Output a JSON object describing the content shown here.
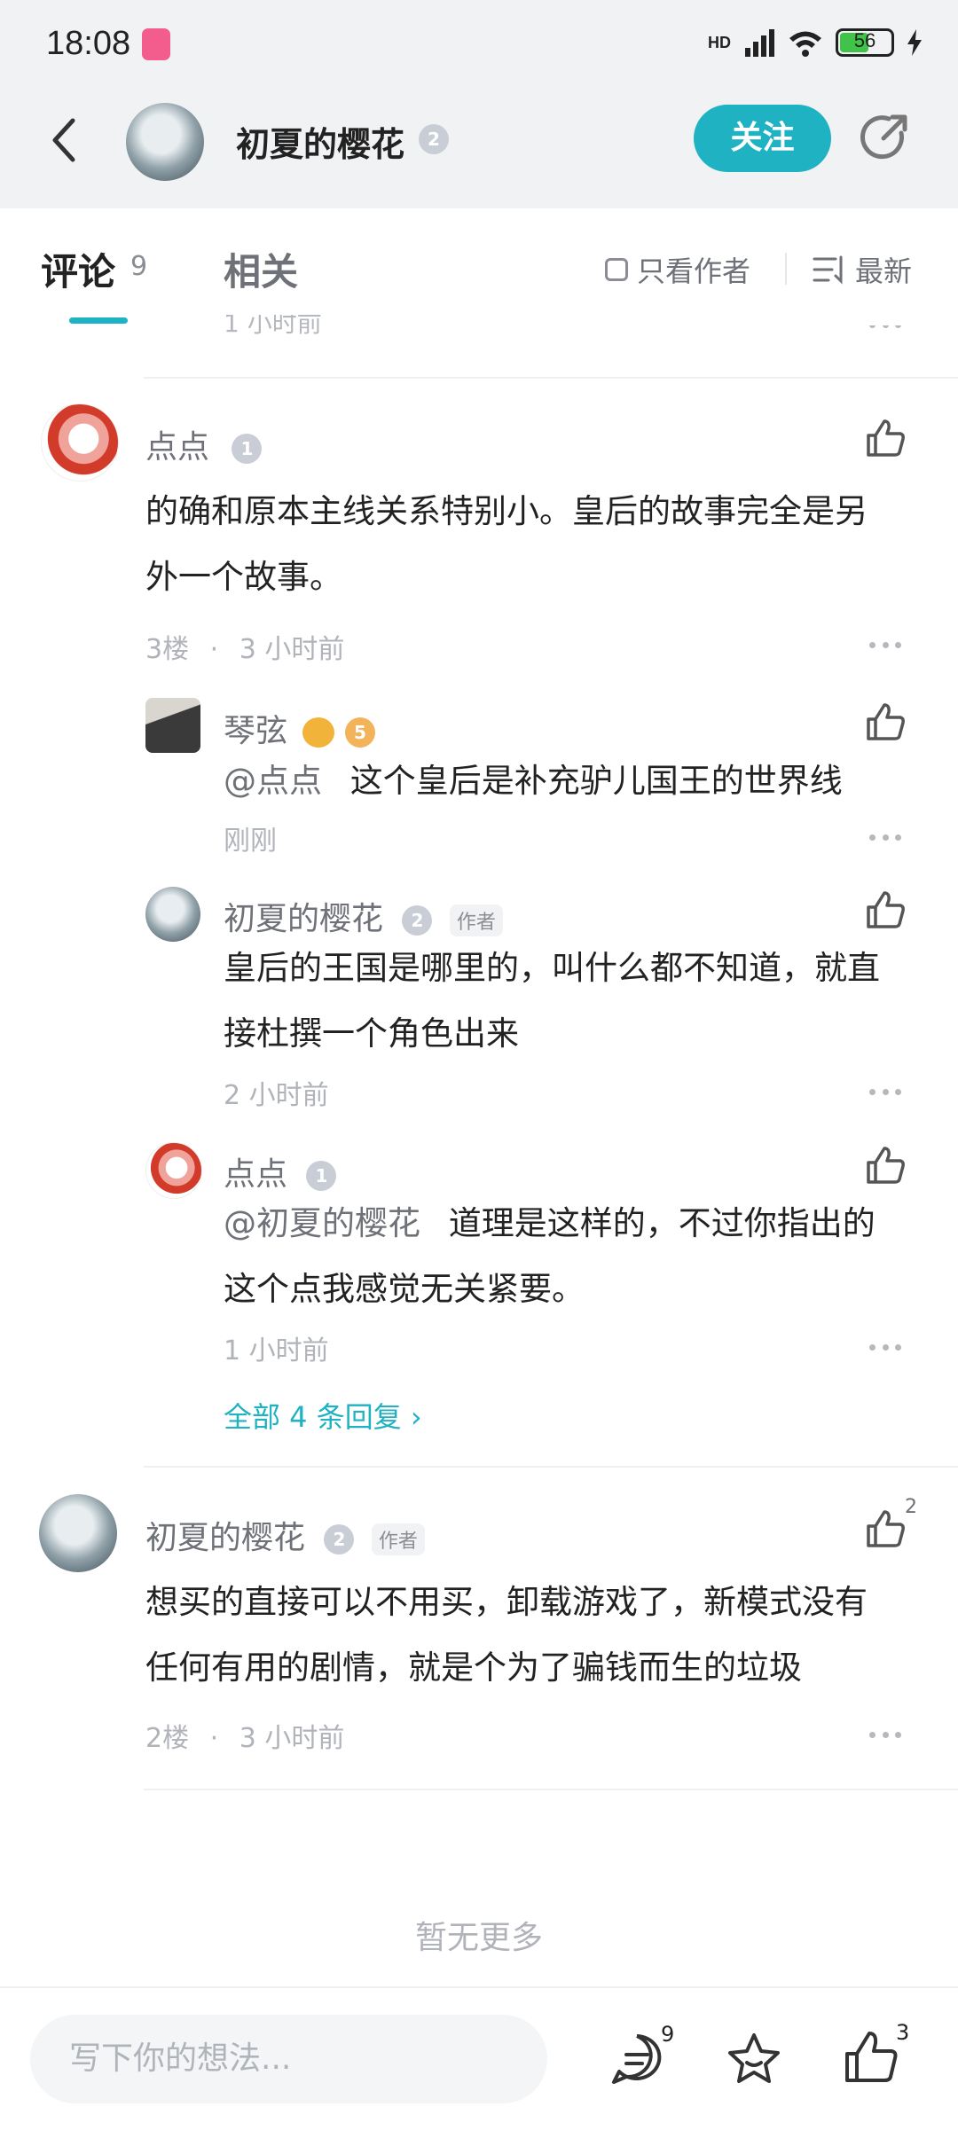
{
  "status": {
    "time": "18:08",
    "battery": "56",
    "network": "HD"
  },
  "header": {
    "name": "初夏的樱花",
    "level": "2",
    "follow_label": "关注"
  },
  "tabs": {
    "comments_label": "评论",
    "comments_count": "9",
    "related_label": "相关",
    "only_author_label": "只看作者",
    "sort_label": "最新"
  },
  "partial": {
    "meta": "1 小时前"
  },
  "comments": [
    {
      "name": "点点",
      "level": "1",
      "text_line1": "的确和原本主线关系特别小。皇后的故事完全是另",
      "text_line2": "外一个故事。",
      "floor": "3楼",
      "time": "3 小时前",
      "replies": [
        {
          "name": "琴弦",
          "level": "5",
          "mention": "@点点",
          "text_line1": "这个皇后是补充驴儿国王的世界线",
          "time": "刚刚"
        },
        {
          "name": "初夏的樱花",
          "level": "2",
          "author_tag": "作者",
          "text_line1": "皇后的王国是哪里的，叫什么都不知道，就直",
          "text_line2": "接杜撰一个角色出来",
          "time": "2 小时前"
        },
        {
          "name": "点点",
          "level": "1",
          "mention": "@初夏的樱花",
          "text_line1": "道理是这样的，不过你指出的",
          "text_line2": "这个点我感觉无关紧要。",
          "time": "1 小时前"
        }
      ],
      "all_replies_label": "全部 4 条回复 ›"
    },
    {
      "name": "初夏的樱花",
      "level": "2",
      "author_tag": "作者",
      "text_line1": "想买的直接可以不用买，卸载游戏了，新模式没有",
      "text_line2": "任何有用的剧情，就是个为了骗钱而生的垃圾",
      "floor": "2楼",
      "time": "3 小时前",
      "likes": "2"
    }
  ],
  "no_more_label": "暂无更多",
  "bottom": {
    "input_placeholder": "写下你的想法...",
    "comment_count": "9",
    "like_count": "3"
  },
  "colors": {
    "accent": "#1fb2c2",
    "page_bg": "#f1f2f4"
  }
}
